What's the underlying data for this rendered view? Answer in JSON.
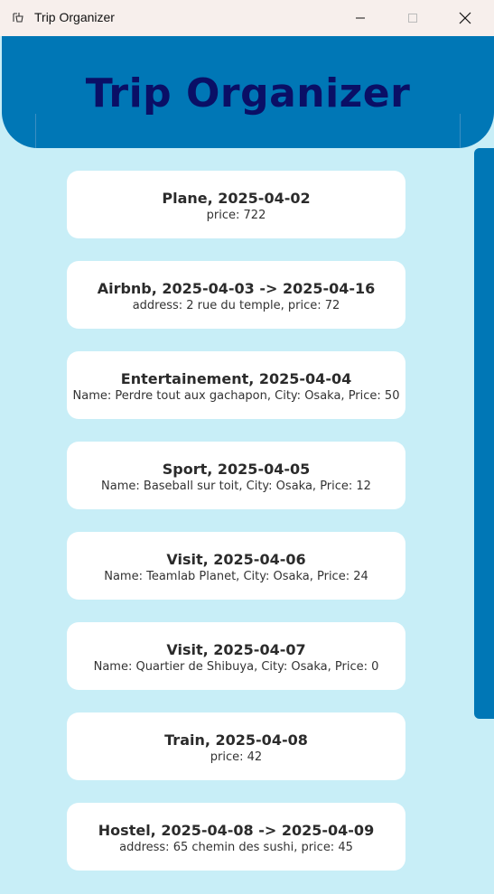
{
  "window": {
    "title": "Trip Organizer",
    "icon": "app-icon",
    "controls": {
      "minimize": "minimize-icon",
      "maximize": "maximize-icon",
      "close": "close-icon"
    }
  },
  "header": {
    "title": "Trip Organizer"
  },
  "colors": {
    "header_bg": "#0077b6",
    "header_title": "#0a0f66",
    "content_bg": "#c8eef7",
    "card_bg": "#ffffff",
    "scrollbar": "#0077b6"
  },
  "items": [
    {
      "title": "Plane, 2025-04-02",
      "detail": "price: 722"
    },
    {
      "title": "Airbnb, 2025-04-03 -> 2025-04-16",
      "detail": "address: 2 rue du temple, price: 72"
    },
    {
      "title": "Entertainement, 2025-04-04",
      "detail": "Name: Perdre tout aux gachapon, City: Osaka, Price: 50"
    },
    {
      "title": "Sport, 2025-04-05",
      "detail": "Name: Baseball sur toit, City: Osaka, Price: 12"
    },
    {
      "title": "Visit, 2025-04-06",
      "detail": "Name: Teamlab Planet, City: Osaka, Price: 24"
    },
    {
      "title": "Visit, 2025-04-07",
      "detail": "Name: Quartier de Shibuya, City: Osaka, Price: 0"
    },
    {
      "title": "Train, 2025-04-08",
      "detail": "price: 42"
    },
    {
      "title": "Hostel, 2025-04-08 -> 2025-04-09",
      "detail": "address: 65 chemin des sushi, price: 45"
    }
  ]
}
